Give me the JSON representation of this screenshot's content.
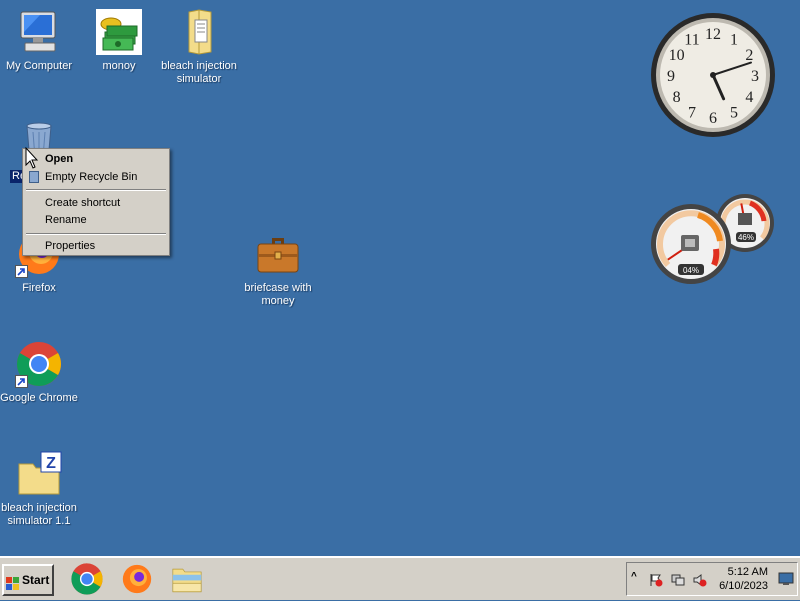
{
  "desktop": {
    "icons": [
      {
        "label": "My Computer"
      },
      {
        "label": "monoy"
      },
      {
        "label": "bleach injection simulator"
      },
      {
        "label": "Re"
      },
      {
        "label": "Firefox"
      },
      {
        "label": "briefcase with money"
      },
      {
        "label": "Google Chrome"
      },
      {
        "label": "bleach injection simulator 1.1"
      }
    ]
  },
  "context_menu": {
    "items": [
      {
        "label": "Open"
      },
      {
        "label": "Empty Recycle Bin"
      },
      {
        "label": "Create shortcut"
      },
      {
        "label": "Rename"
      },
      {
        "label": "Properties"
      }
    ]
  },
  "gadgets": {
    "clock": {
      "numerals": [
        "12",
        "1",
        "2",
        "3",
        "4",
        "5",
        "6",
        "7",
        "8",
        "9",
        "10",
        "11"
      ],
      "hour": 5,
      "minute": 12
    },
    "cpu_meter": {
      "cpu_label": "04%",
      "memory_label": "46%",
      "cpu_value": 4,
      "memory_value": 46
    }
  },
  "taskbar": {
    "start_label": "Start",
    "apps": [
      {
        "icon": "chrome-icon"
      },
      {
        "icon": "firefox-icon"
      },
      {
        "icon": "file-explorer-icon"
      }
    ],
    "tray": {
      "time": "5:12 AM",
      "date": "6/10/2023"
    }
  },
  "colors": {
    "desktop": "#3a6ea5",
    "taskbar": "#d4d0c8"
  }
}
